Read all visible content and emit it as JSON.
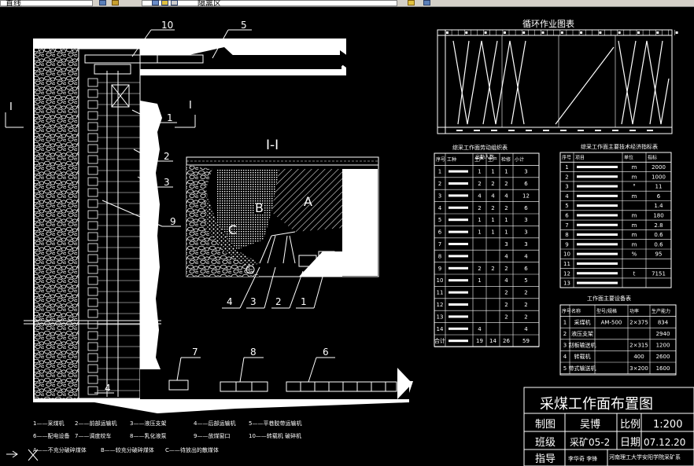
{
  "toolbar": {
    "left_text": "直线",
    "layer_text": "隔离区",
    "icons": [
      "app-icon",
      "layer-icon",
      "bulb-icon",
      "sun-icon",
      "lock-icon",
      "color-icon",
      "property-icon"
    ]
  },
  "plan": {
    "section_mark_left": "I",
    "section_mark_right": "I",
    "section_title": "I-I",
    "callouts": [
      "10",
      "5",
      "1",
      "2",
      "3",
      "9",
      "4",
      "7",
      "8",
      "6"
    ],
    "section_callouts": [
      "4",
      "3",
      "2",
      "1"
    ],
    "zones": [
      "A",
      "B",
      "C"
    ]
  },
  "cycle_chart": {
    "title": "循环作业图表"
  },
  "table_left": {
    "title": "综采工作面劳动组织表",
    "headers": [
      "序号",
      "工种",
      "出勤人数",
      "小计"
    ],
    "shift_headers": [
      "生产",
      "生产",
      "检修"
    ],
    "rows": [
      [
        "1",
        "",
        "1",
        "1",
        "1",
        "3"
      ],
      [
        "2",
        "",
        "2",
        "2",
        "2",
        "6"
      ],
      [
        "3",
        "",
        "4",
        "4",
        "4",
        "12"
      ],
      [
        "4",
        "",
        "2",
        "2",
        "2",
        "6"
      ],
      [
        "5",
        "",
        "1",
        "1",
        "1",
        "3"
      ],
      [
        "6",
        "",
        "1",
        "1",
        "1",
        "3"
      ],
      [
        "7",
        "",
        "",
        "",
        "3",
        "3"
      ],
      [
        "8",
        "",
        "",
        "",
        "4",
        "4"
      ],
      [
        "9",
        "",
        "2",
        "2",
        "2",
        "6"
      ],
      [
        "10",
        "",
        "1",
        "",
        "4",
        "5"
      ],
      [
        "11",
        "",
        "",
        "",
        "2",
        "2"
      ],
      [
        "12",
        "",
        "",
        "",
        "2",
        "2"
      ],
      [
        "13",
        "",
        "",
        "",
        "2",
        "2"
      ],
      [
        "14",
        "",
        "4",
        "",
        "",
        "4"
      ],
      [
        "合计",
        "",
        "19",
        "14",
        "26",
        "59"
      ]
    ]
  },
  "table_right": {
    "title": "综采工作面主要技术经济指标表",
    "headers": [
      "序号",
      "项目",
      "单位",
      "指标"
    ],
    "rows": [
      [
        "1",
        "",
        "m",
        "2000"
      ],
      [
        "2",
        "",
        "m",
        "1000"
      ],
      [
        "3",
        "",
        "°",
        "11"
      ],
      [
        "4",
        "",
        "m",
        "6"
      ],
      [
        "5",
        "",
        "",
        "1.4"
      ],
      [
        "6",
        "",
        "m",
        "180"
      ],
      [
        "7",
        "",
        "m",
        "2.8"
      ],
      [
        "8",
        "",
        "m",
        "0.6"
      ],
      [
        "9",
        "",
        "m",
        "0.6"
      ],
      [
        "10",
        "",
        "%",
        "95"
      ],
      [
        "11",
        "",
        "",
        ""
      ],
      [
        "12",
        "",
        "t",
        "7151"
      ],
      [
        "13",
        "",
        "",
        ""
      ]
    ]
  },
  "table_equip": {
    "title": "工作面主要设备表",
    "headers": [
      "序号",
      "名称",
      "型号/规格",
      "功率",
      "生产能力"
    ],
    "rows": [
      [
        "1",
        "采煤机",
        "AM-500",
        "2×375",
        "834"
      ],
      [
        "2",
        "液压支架",
        "",
        "",
        "2940"
      ],
      [
        "3",
        "刮板输送机",
        "",
        "2×315",
        "1200"
      ],
      [
        "4",
        "转载机",
        "",
        "400",
        "2600"
      ],
      [
        "5",
        "带式输送机",
        "",
        "3×200",
        "1600"
      ]
    ]
  },
  "legend": {
    "items": [
      "1——采煤机",
      "2——前部运输机",
      "3——液压支架",
      "4——后部运输机",
      "5——平巷胶带运输机",
      "6——配电设备",
      "7——调度绞车",
      "8——乳化液泵",
      "9——放煤窗口",
      "10——转载机 破碎机",
      "A——不充分破碎煤体",
      "B——较充分破碎煤体",
      "C——待放出的散煤体"
    ]
  },
  "title_block": {
    "title": "采煤工作面布置图",
    "drawn_label": "制图",
    "drawn_value": "吴博",
    "scale_label": "比例",
    "scale_value": "1:200",
    "class_label": "班级",
    "class_value": "采矿05-2",
    "date_label": "日期",
    "date_value": "07.12.20",
    "guide_label": "指导",
    "guide_value": "李华奇 李锋",
    "school_value": "河南理工大学安阳学院采矿系"
  }
}
